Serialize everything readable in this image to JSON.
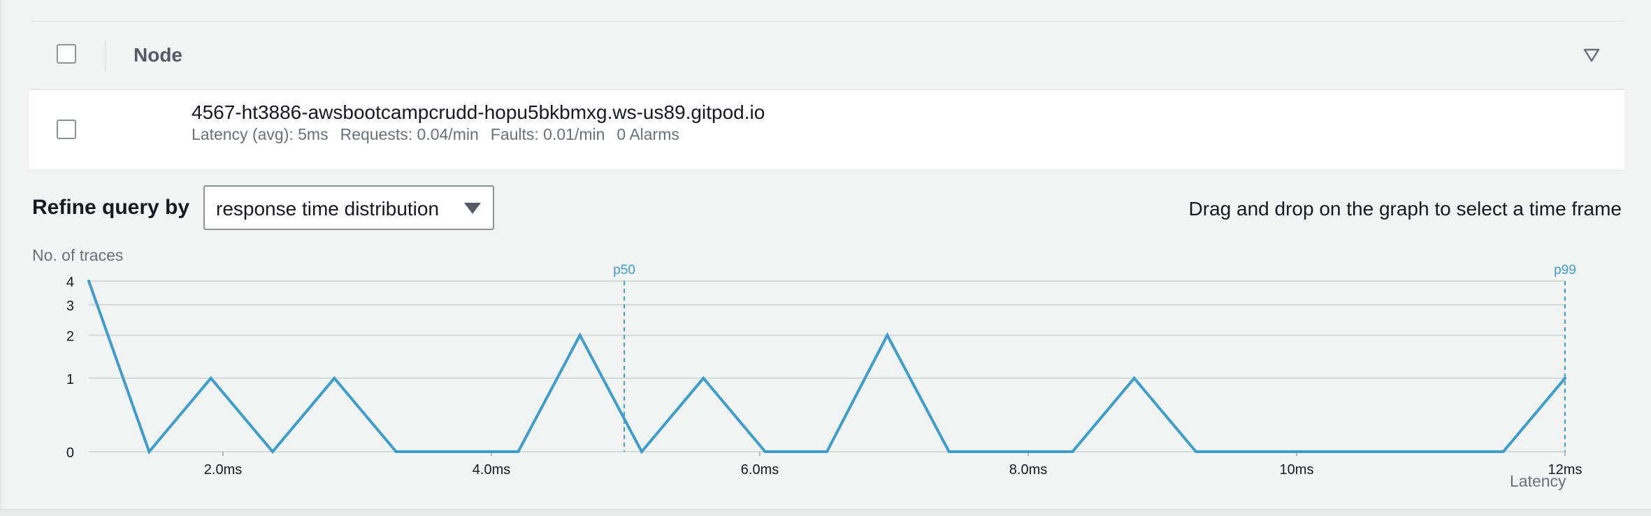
{
  "table": {
    "header": {
      "column_label": "Node"
    },
    "rows": [
      {
        "name": "4567-ht3886-awsbootcampcrudd-hopu5bkbmxg.ws-us89.gitpod.io",
        "latency": "Latency (avg): 5ms",
        "requests": "Requests: 0.04/min",
        "faults": "Faults: 0.01/min",
        "alarms": "0 Alarms"
      }
    ]
  },
  "refine": {
    "label": "Refine query by",
    "selected": "response time distribution",
    "hint": "Drag and drop on the graph to select a time frame"
  },
  "icons": {
    "sort": "sort-down-icon",
    "caret": "caret-down-icon"
  },
  "colors": {
    "series": "#3d9ec9",
    "marker": "#3d9ec9",
    "grid": "#d5dbdb"
  },
  "chart_data": {
    "type": "line",
    "ylabel": "No. of traces",
    "xlabel": "Latency",
    "x_ticks": [
      {
        "value": 2,
        "label": "2.0ms"
      },
      {
        "value": 4,
        "label": "4.0ms"
      },
      {
        "value": 6,
        "label": "6.0ms"
      },
      {
        "value": 8,
        "label": "8.0ms"
      },
      {
        "value": 10,
        "label": "10ms"
      },
      {
        "value": 12,
        "label": "12ms"
      }
    ],
    "y_ticks": [
      0,
      1,
      2,
      3,
      4
    ],
    "y_scale": "log(1+y)",
    "xlim": [
      1.0,
      12.0
    ],
    "ylim": [
      0,
      4
    ],
    "grid": true,
    "markers": [
      {
        "label": "p50",
        "x": 4.99
      },
      {
        "label": "p99",
        "x": 12.0
      }
    ],
    "series": [
      {
        "x": [
          1.0,
          1.45,
          1.91,
          2.37,
          2.83,
          3.29,
          3.74,
          4.2,
          4.66,
          5.12,
          5.58,
          6.04,
          6.5,
          6.95,
          7.41,
          7.87,
          8.33,
          8.79,
          9.25,
          9.71,
          10.16,
          10.62,
          11.08,
          11.54,
          12.0
        ],
        "y": [
          4,
          0,
          1,
          0,
          1,
          0,
          0,
          0,
          2,
          0,
          1,
          0,
          0,
          2,
          0,
          0,
          0,
          1,
          0,
          0,
          0,
          0,
          0,
          0,
          1
        ]
      }
    ]
  }
}
